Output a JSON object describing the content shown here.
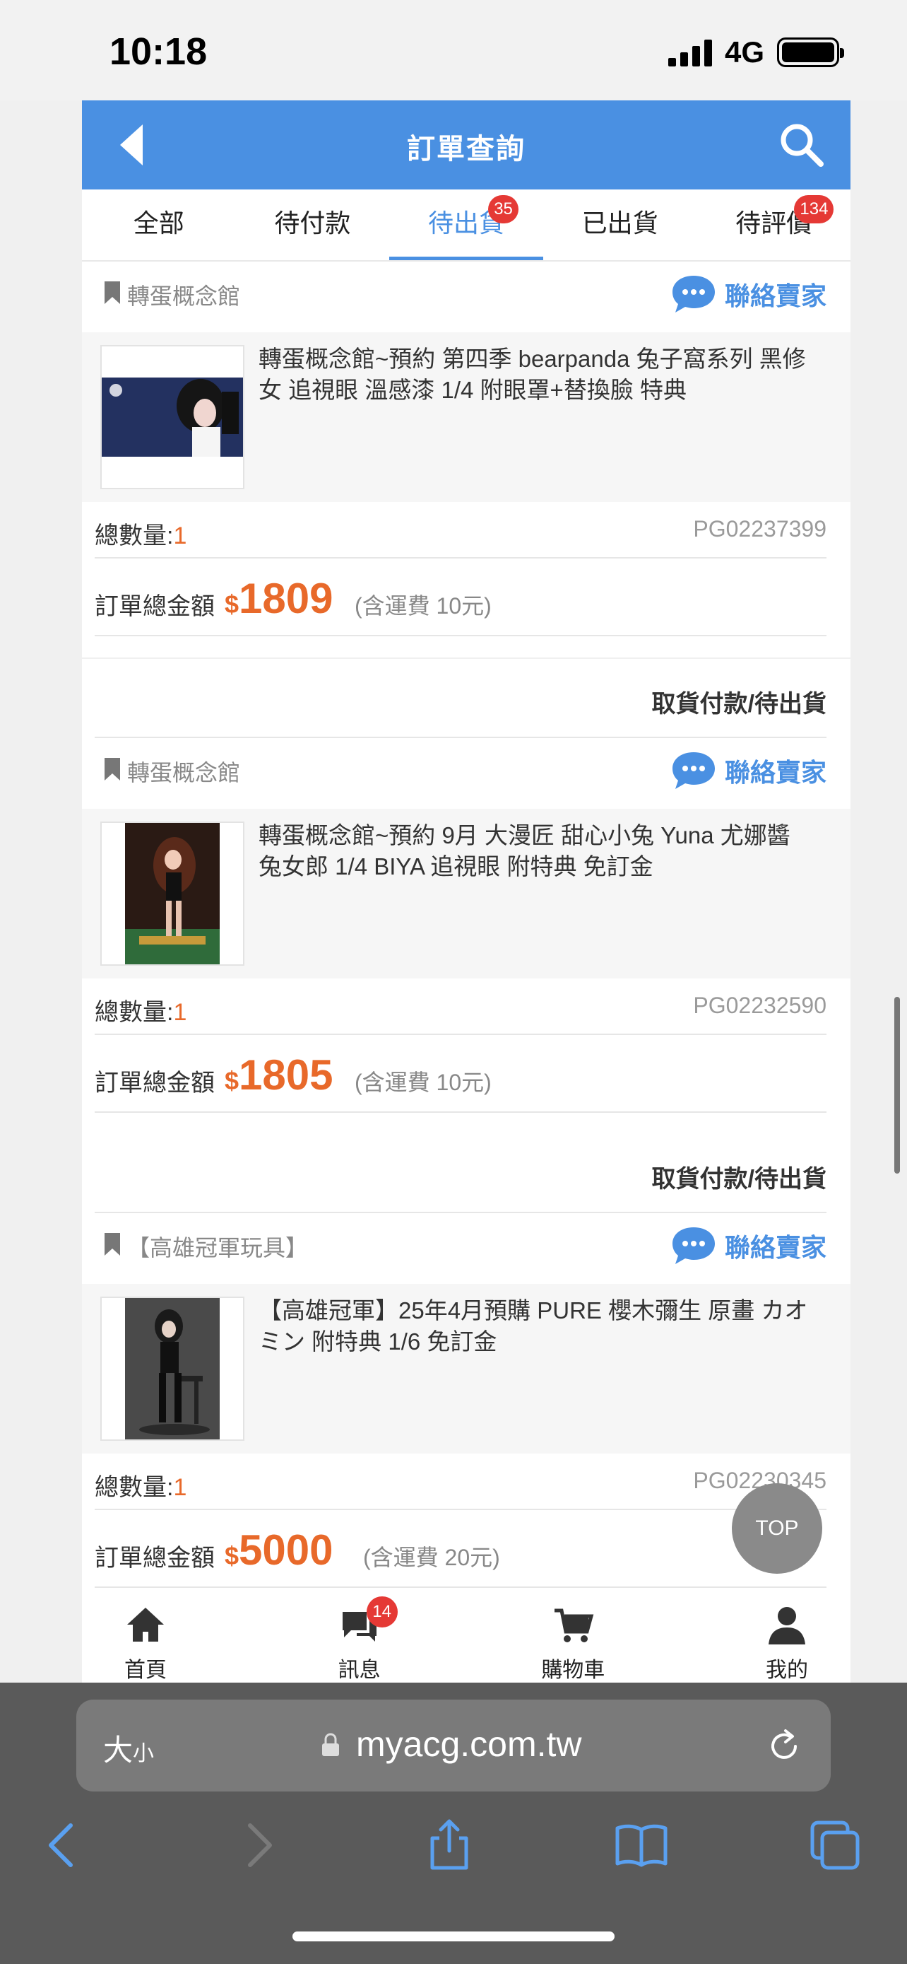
{
  "status_bar": {
    "time": "10:18",
    "network": "4G"
  },
  "header": {
    "title": "訂單查詢"
  },
  "tabs": [
    {
      "label": "全部",
      "badge": ""
    },
    {
      "label": "待付款",
      "badge": ""
    },
    {
      "label": "待出貨",
      "badge": "35"
    },
    {
      "label": "已出貨",
      "badge": ""
    },
    {
      "label": "待評價",
      "badge": "134"
    }
  ],
  "common": {
    "contact_label": "聯絡賣家",
    "qty_label": "總數量:",
    "total_label": "訂單總金額",
    "currency": "$"
  },
  "orders": [
    {
      "status": "",
      "shop": "轉蛋概念館",
      "title": "轉蛋概念館~預約 第四季 bearpanda 兔子窩系列 黑修女 追視眼 溫感漆 1/4 附眼罩+替換臉 特典",
      "qty": "1",
      "order_no": "PG02237399",
      "total": "1809",
      "shipping": "(含運費 10元)"
    },
    {
      "status": "取貨付款/待出貨",
      "shop": "轉蛋概念館",
      "title": "轉蛋概念館~預約 9月 大漫匠 甜心小兔 Yuna 尤娜醬 兔女郎 1/4 BIYA 追視眼 附特典 免訂金",
      "qty": "1",
      "order_no": "PG02232590",
      "total": "1805",
      "shipping": "(含運費 10元)"
    },
    {
      "status": "取貨付款/待出貨",
      "shop": "【高雄冠軍玩具】",
      "title": "【高雄冠軍】25年4月預購 PURE 櫻木彌生 原畫 カオミン 附特典 1/6 免訂金",
      "qty": "1",
      "order_no": "PG02230345",
      "total": "5000",
      "shipping": "(含運費 20元)"
    }
  ],
  "top_button": "TOP",
  "bottom_nav": [
    {
      "label": "首頁",
      "badge": "",
      "icon": "home-icon"
    },
    {
      "label": "訊息",
      "badge": "14",
      "icon": "message-icon"
    },
    {
      "label": "購物車",
      "badge": "",
      "icon": "cart-icon"
    },
    {
      "label": "我的",
      "badge": "",
      "icon": "user-icon"
    }
  ],
  "safari": {
    "text_size_label": "大",
    "text_size_small": "小",
    "url": "myacg.com.tw"
  },
  "colors": {
    "header_blue": "#4a90e2",
    "price_orange": "#e8692a",
    "badge_red": "#e53935"
  }
}
